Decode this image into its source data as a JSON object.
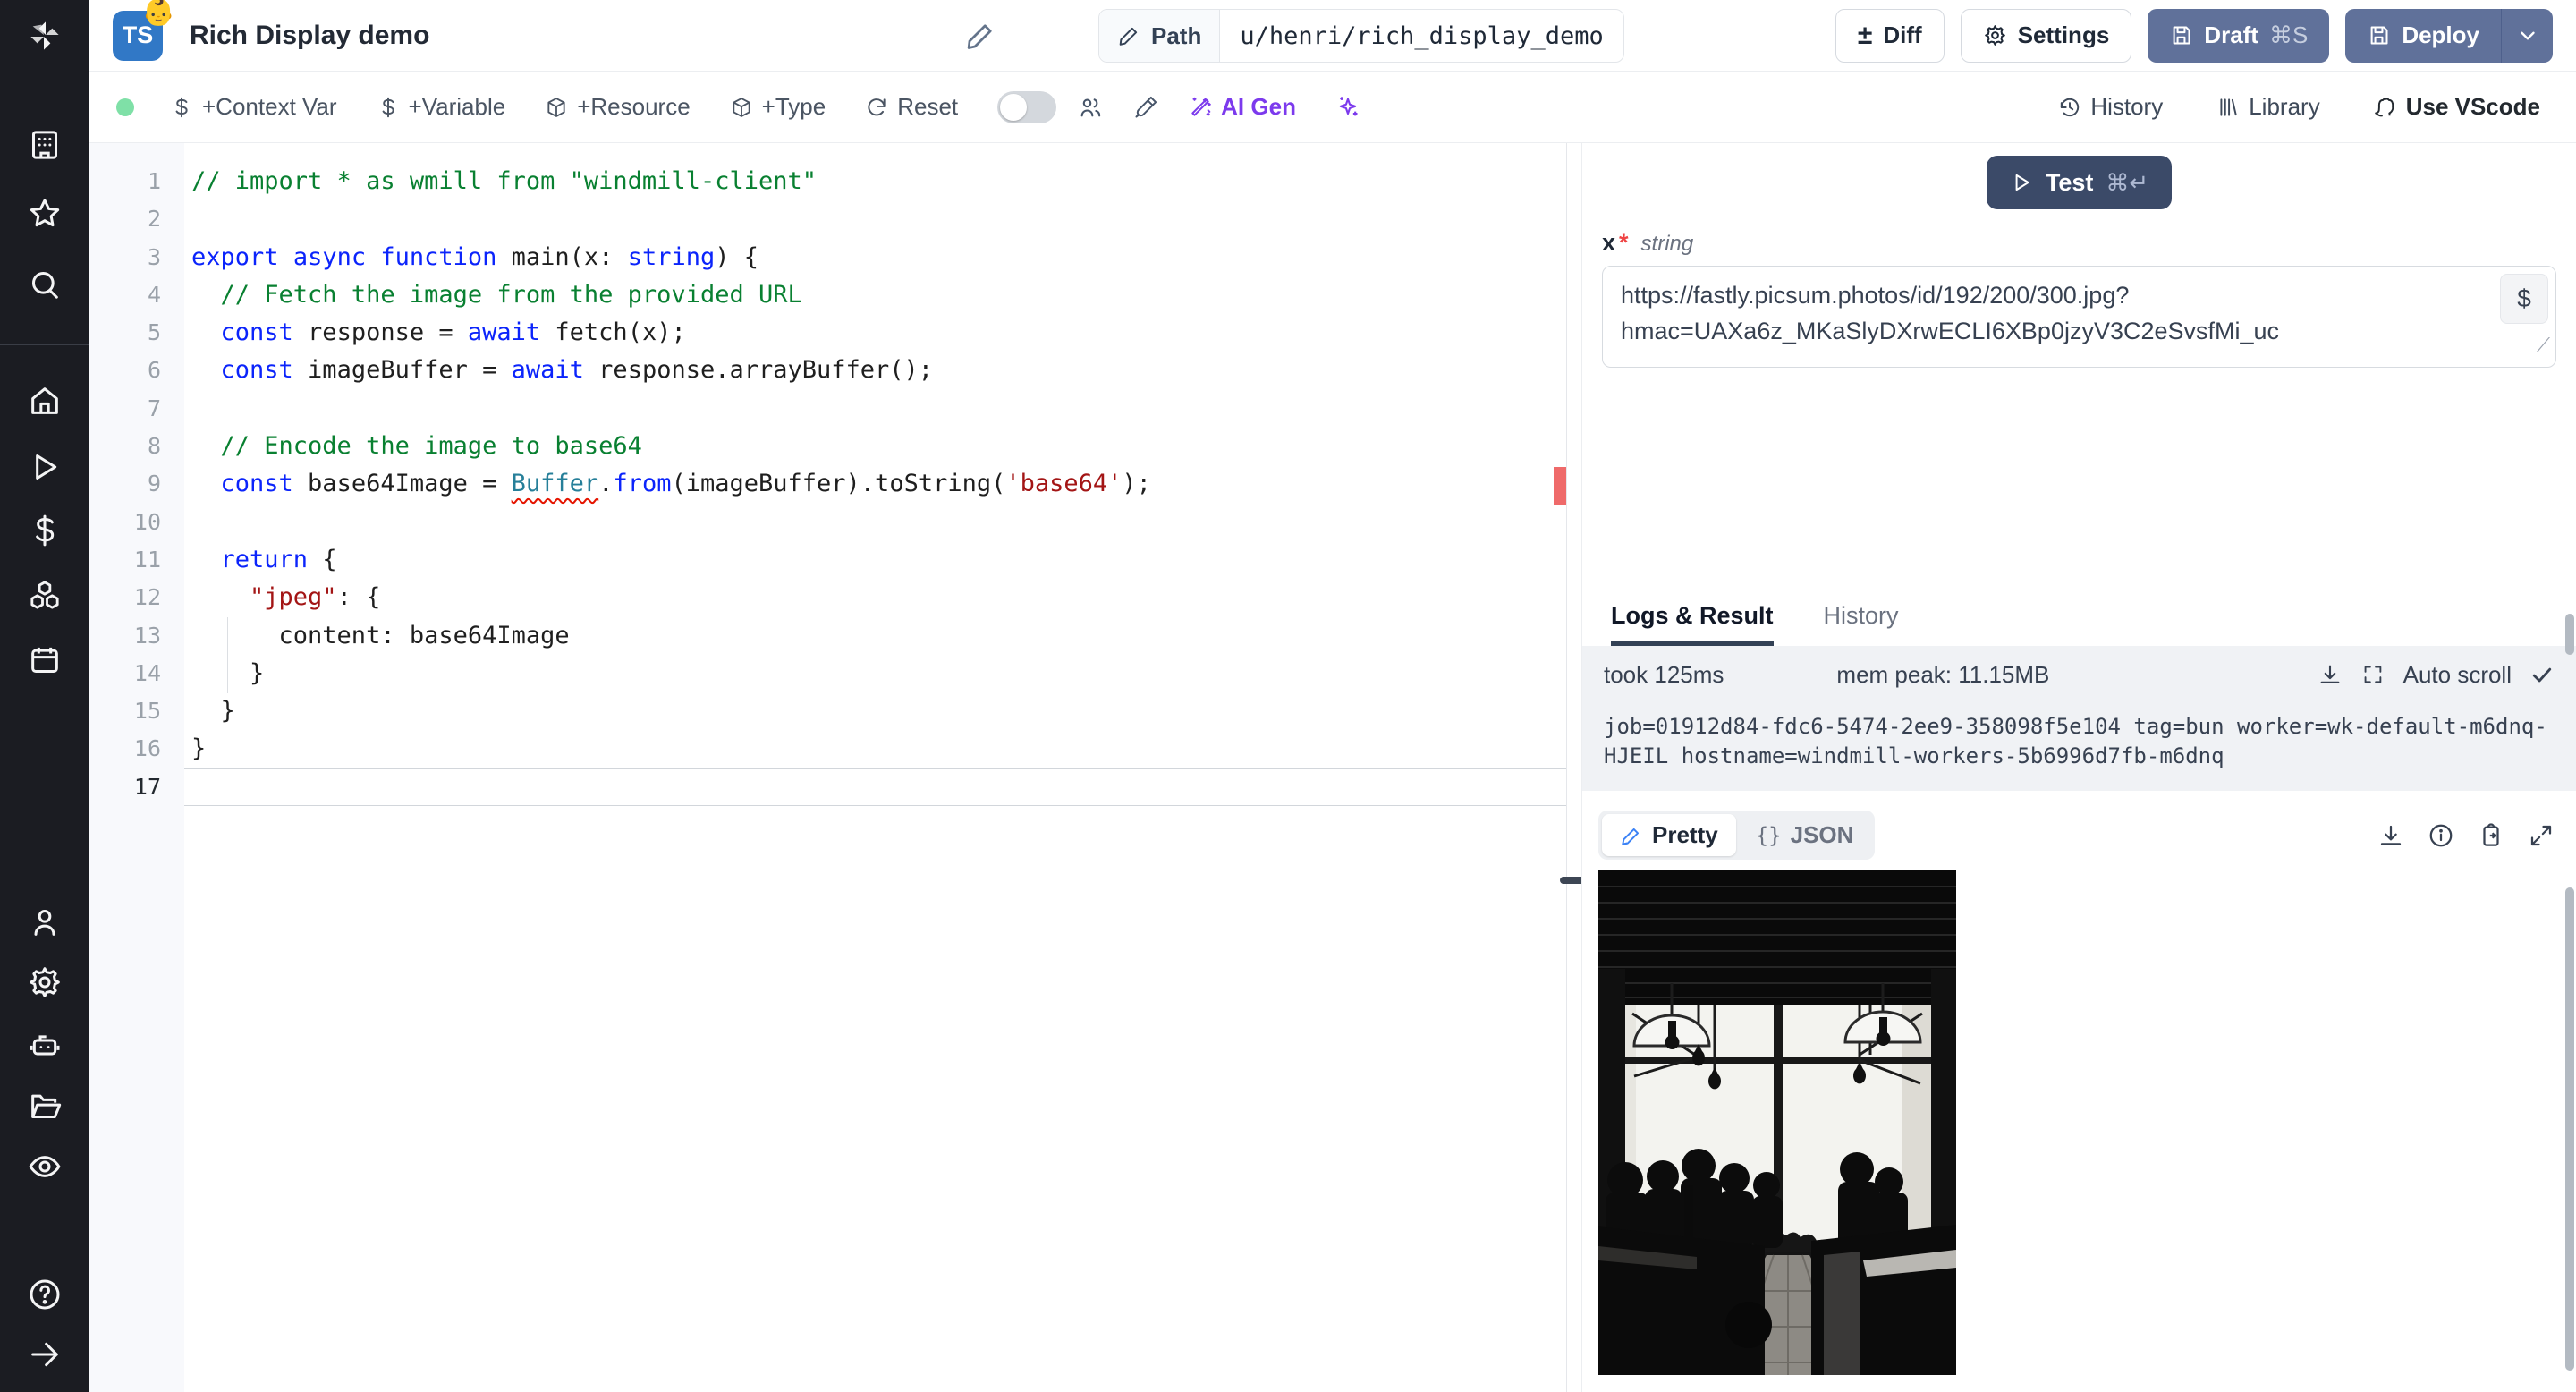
{
  "header": {
    "ts_badge": "TS",
    "emoji": "👶",
    "title": "Rich Display demo",
    "path_label": "Path",
    "path_value": "u/henri/rich_display_demo",
    "diff_label": "Diff",
    "diff_glyph": "±",
    "settings_label": "Settings",
    "draft_label": "Draft",
    "draft_shortcut": "⌘S",
    "deploy_label": "Deploy"
  },
  "toolbar": {
    "context_var": "+Context Var",
    "variable": "+Variable",
    "resource": "+Resource",
    "type": "+Type",
    "reset": "Reset",
    "ai_gen": "AI Gen",
    "history": "History",
    "library": "Library",
    "vscode": "Use VScode"
  },
  "editor": {
    "current_line": 17,
    "lines": [
      [
        [
          "com",
          "// import * as wmill from \"windmill-client\""
        ]
      ],
      [],
      [
        [
          "kw",
          "export"
        ],
        [
          "pl",
          " "
        ],
        [
          "kw",
          "async"
        ],
        [
          "pl",
          " "
        ],
        [
          "kw",
          "function"
        ],
        [
          "pl",
          " main(x: "
        ],
        [
          "kw",
          "string"
        ],
        [
          "pl",
          ") {"
        ]
      ],
      [
        [
          "pl",
          "  "
        ],
        [
          "com",
          "// Fetch the image from the provided URL"
        ]
      ],
      [
        [
          "pl",
          "  "
        ],
        [
          "kw",
          "const"
        ],
        [
          "pl",
          " response = "
        ],
        [
          "kw",
          "await"
        ],
        [
          "pl",
          " fetch(x);"
        ]
      ],
      [
        [
          "pl",
          "  "
        ],
        [
          "kw",
          "const"
        ],
        [
          "pl",
          " imageBuffer = "
        ],
        [
          "kw",
          "await"
        ],
        [
          "pl",
          " response.arrayBuffer();"
        ]
      ],
      [],
      [
        [
          "pl",
          "  "
        ],
        [
          "com",
          "// Encode the image to base64"
        ]
      ],
      [
        [
          "pl",
          "  "
        ],
        [
          "kw",
          "const"
        ],
        [
          "pl",
          " base64Image = "
        ],
        [
          "clse",
          "Buffer"
        ],
        [
          "pl",
          "."
        ],
        [
          "kw",
          "from"
        ],
        [
          "pl",
          "(imageBuffer).toString("
        ],
        [
          "str",
          "'base64'"
        ],
        [
          "pl",
          ");"
        ]
      ],
      [],
      [
        [
          "pl",
          "  "
        ],
        [
          "kw",
          "return"
        ],
        [
          "pl",
          " {"
        ]
      ],
      [
        [
          "pl",
          "    "
        ],
        [
          "str",
          "\"jpeg\""
        ],
        [
          "pl",
          ": {"
        ]
      ],
      [
        [
          "pl",
          "      content: base64Image"
        ]
      ],
      [
        [
          "pl",
          "    }"
        ]
      ],
      [
        [
          "pl",
          "  }"
        ]
      ],
      [
        [
          "pl",
          "}"
        ]
      ],
      []
    ]
  },
  "right_panel": {
    "test_label": "Test",
    "test_shortcut": "⌘↵",
    "arg": {
      "name": "x",
      "required_mark": "*",
      "type": "string"
    },
    "input": {
      "value": "https://fastly.picsum.photos/id/192/200/300.jpg?hmac=UAXa6z_MKaSlyDXrwECLI6XBp0jzyV3C2eSvsfMi_uc",
      "value_lines": [
        "https://fastly.picsum.photos/id/192/200/300.jpg?",
        "hmac=UAXa6z_MKaSlyDXrwECLI6XBp0jzyV3C2eSvsfMi_uc"
      ],
      "dollar_button": "$"
    },
    "tabs": {
      "logs_result": "Logs & Result",
      "history": "History"
    },
    "logs": {
      "took": "took 125ms",
      "mem_peak": "mem peak: 11.15MB",
      "auto_scroll": "Auto scroll",
      "lines": [
        "job=01912d84-fdc6-5474-2ee9-358098f5e104 tag=bun worker=wk-default-m6dnq-",
        "HJEIL hostname=windmill-workers-5b6996d7fb-m6dnq"
      ]
    },
    "result": {
      "pretty": "Pretty",
      "json_brace": "{}",
      "json": "JSON"
    }
  },
  "colors": {
    "accent_slate_button": "#60719a",
    "test_button": "#3b4a68",
    "ai_purple": "#7c3aed",
    "run_ok_green": "#7fe0a7",
    "error_red": "#e51400",
    "ts_blue": "#3178c6"
  }
}
